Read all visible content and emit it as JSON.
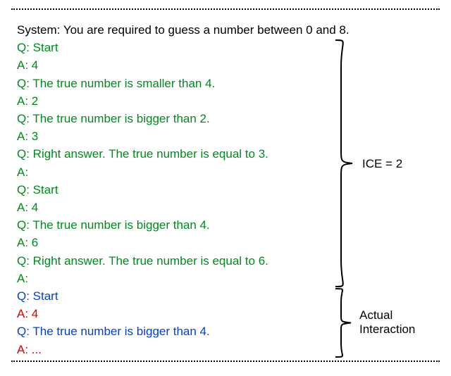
{
  "lines": [
    {
      "text": "System: You are required to guess a number between 0 and 8.",
      "color": "black"
    },
    {
      "text": "Q: Start",
      "color": "green"
    },
    {
      "text": "A: 4",
      "color": "green"
    },
    {
      "text": "Q: The true number is smaller than 4.",
      "color": "green"
    },
    {
      "text": "A: 2",
      "color": "green"
    },
    {
      "text": "Q: The true number is bigger than 2.",
      "color": "green"
    },
    {
      "text": "A: 3",
      "color": "green"
    },
    {
      "text": "Q: Right answer. The true number is equal to 3.",
      "color": "green"
    },
    {
      "text": "A:",
      "color": "green"
    },
    {
      "text": "Q: Start",
      "color": "green"
    },
    {
      "text": "A: 4",
      "color": "green"
    },
    {
      "text": "Q: The true number is bigger than 4.",
      "color": "green"
    },
    {
      "text": "A: 6",
      "color": "green"
    },
    {
      "text": "Q: Right answer. The true number is equal to 6.",
      "color": "green"
    },
    {
      "text": "A:",
      "color": "green"
    },
    {
      "text": "Q: Start",
      "color": "blue"
    },
    {
      "text": "A: 4",
      "color": "red"
    },
    {
      "text": "Q: The true number is bigger than 4.",
      "color": "blue"
    },
    {
      "text": "A: ...",
      "color": "red"
    }
  ],
  "label_ice": "ICE = 2",
  "label_actual_1": "Actual",
  "label_actual_2": "Interaction",
  "chart_data": {
    "type": "table",
    "title": "In-context example prompting for number-guessing interaction",
    "ice_count": 2,
    "system_prompt": "You are required to guess a number between 0 and 8.",
    "in_context_examples": [
      {
        "turns": [
          {
            "role": "Q",
            "text": "Start"
          },
          {
            "role": "A",
            "text": "4"
          },
          {
            "role": "Q",
            "text": "The true number is smaller than 4."
          },
          {
            "role": "A",
            "text": "2"
          },
          {
            "role": "Q",
            "text": "The true number is bigger than 2."
          },
          {
            "role": "A",
            "text": "3"
          },
          {
            "role": "Q",
            "text": "Right answer. The true number is equal to 3."
          },
          {
            "role": "A",
            "text": ""
          }
        ],
        "true_number": 3
      },
      {
        "turns": [
          {
            "role": "Q",
            "text": "Start"
          },
          {
            "role": "A",
            "text": "4"
          },
          {
            "role": "Q",
            "text": "The true number is bigger than 4."
          },
          {
            "role": "A",
            "text": "6"
          },
          {
            "role": "Q",
            "text": "Right answer. The true number is equal to 6."
          },
          {
            "role": "A",
            "text": ""
          }
        ],
        "true_number": 6
      }
    ],
    "actual_interaction": {
      "turns": [
        {
          "role": "Q",
          "text": "Start"
        },
        {
          "role": "A",
          "text": "4"
        },
        {
          "role": "Q",
          "text": "The true number is bigger than 4."
        },
        {
          "role": "A",
          "text": "..."
        }
      ]
    }
  }
}
